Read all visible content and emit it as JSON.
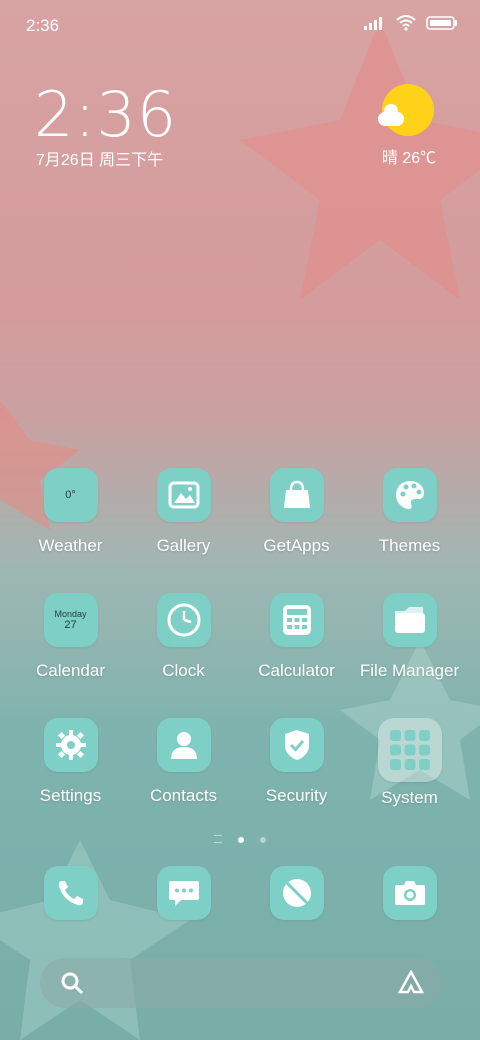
{
  "status": {
    "time": "2:36"
  },
  "lockclock": {
    "time": "2:36",
    "date": "7月26日 周三下午"
  },
  "weather_widget": {
    "text": "晴 26℃"
  },
  "apps": [
    {
      "label": "Weather",
      "icon": "weather-icon",
      "sub": "0°"
    },
    {
      "label": "Gallery",
      "icon": "gallery-icon"
    },
    {
      "label": "GetApps",
      "icon": "shopping-bag-icon"
    },
    {
      "label": "Themes",
      "icon": "palette-icon"
    },
    {
      "label": "Calendar",
      "icon": "calendar-icon",
      "sub1": "Monday",
      "sub2": "27"
    },
    {
      "label": "Clock",
      "icon": "clock-icon"
    },
    {
      "label": "Calculator",
      "icon": "calculator-icon"
    },
    {
      "label": "File Manager",
      "icon": "folder-icon"
    },
    {
      "label": "Settings",
      "icon": "gear-icon"
    },
    {
      "label": "Contacts",
      "icon": "contact-icon"
    },
    {
      "label": "Security",
      "icon": "shield-icon"
    },
    {
      "label": "System",
      "icon": "folder-grid-icon"
    }
  ],
  "dock": [
    {
      "icon": "phone-icon"
    },
    {
      "icon": "message-icon"
    },
    {
      "icon": "browser-icon"
    },
    {
      "icon": "camera-icon"
    }
  ],
  "page_indicator": {
    "count": 2,
    "active": 0
  }
}
